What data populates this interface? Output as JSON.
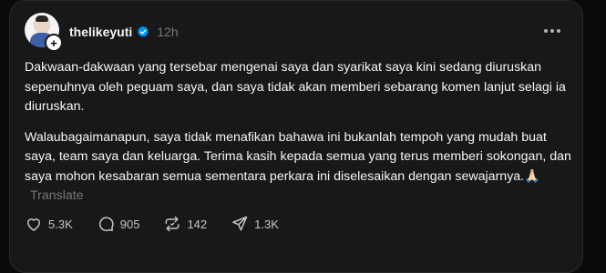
{
  "post": {
    "username": "thelikeyuti",
    "time": "12h",
    "paragraphs": [
      "Dakwaan-dakwaan yang tersebar mengenai saya dan syarikat saya kini sedang diuruskan sepenuhnya oleh peguam saya, dan saya tidak akan memberi sebarang komen lanjut selagi ia diuruskan.",
      "Walaubagaimanapun, saya tidak menafikan bahawa ini bukanlah tempoh yang mudah buat saya, team saya dan keluarga. Terima kasih kepada semua yang terus memberi sokongan, dan saya mohon kesabaran semua sementara perkara ini diselesaikan dengan sewajarnya.🙏🏻"
    ],
    "translate_label": "Translate"
  },
  "actions": {
    "likes": "5.3K",
    "replies": "905",
    "reposts": "142",
    "shares": "1.3K"
  },
  "icons": {
    "avatar": "avatar",
    "follow": "plus-icon",
    "verified": "verified-badge-icon",
    "more": "more-dots-icon",
    "like": "heart-icon",
    "reply": "comment-icon",
    "repost": "repost-icon",
    "share": "send-icon"
  },
  "colors": {
    "background": "#181818",
    "text": "#f3f5f7",
    "muted": "#777777",
    "verified": "#0095f6"
  }
}
